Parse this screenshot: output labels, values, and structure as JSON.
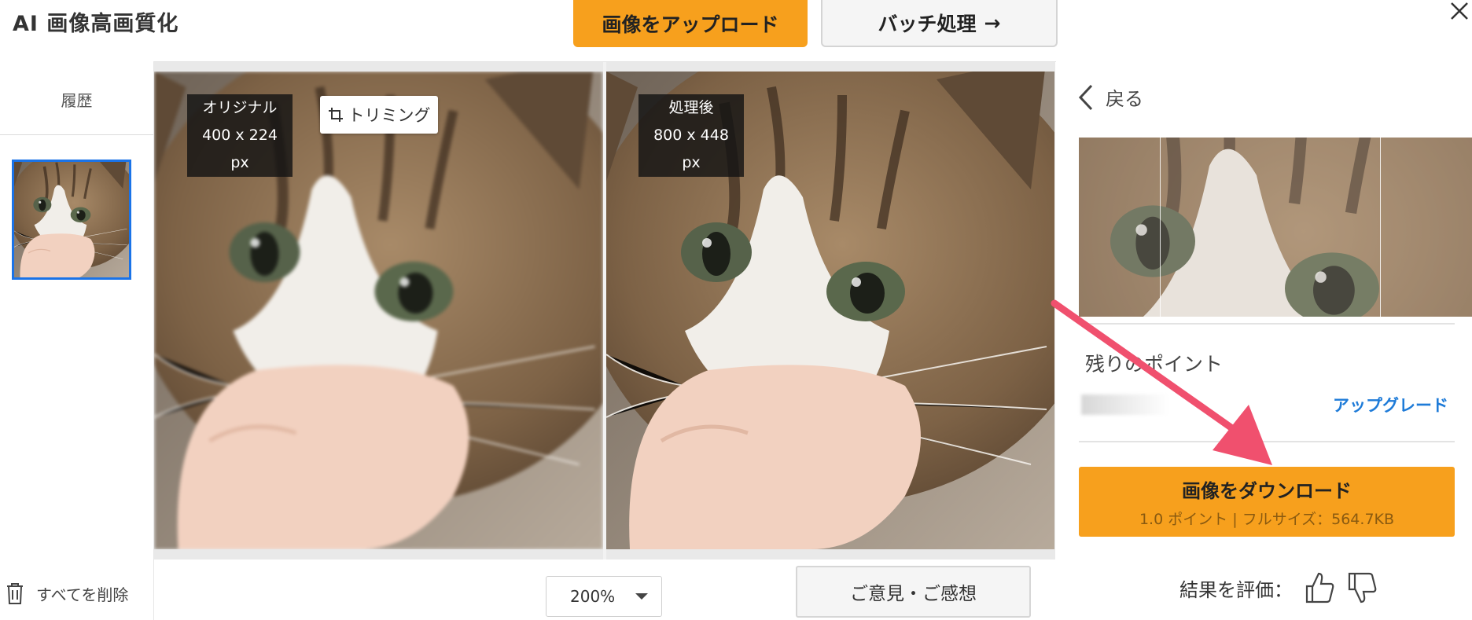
{
  "header": {
    "title": "AI 画像高画質化",
    "upload_label": "画像をアップロード",
    "batch_label": "バッチ処理",
    "batch_arrow": "→"
  },
  "history": {
    "label": "履歴",
    "delete_all_label": "すべてを削除"
  },
  "compare": {
    "original": {
      "title": "オリジナル",
      "size": "400 x 224 px"
    },
    "processed": {
      "title": "処理後",
      "size": "800 x 448 px"
    },
    "crop_label": "トリミング"
  },
  "bottom_bar": {
    "zoom_value": "200%",
    "feedback_label": "ご意見・ご感想"
  },
  "right_panel": {
    "back_label": "戻る",
    "points_label": "残りのポイント",
    "upgrade_label": "アップグレード",
    "download_label": "画像をダウンロード",
    "download_sub": "1.0 ポイント | フルサイズ：564.7KB",
    "rate_label": "結果を評価："
  },
  "colors": {
    "accent_orange": "#f7a01d",
    "selection_blue": "#1a73e8",
    "link_blue": "#1e7bd8",
    "annotation_arrow": "#f0506e"
  },
  "icons": [
    "close-icon",
    "crop-icon",
    "trash-icon",
    "chevron-left-icon",
    "chevron-down-icon",
    "thumbs-up-icon",
    "thumbs-down-icon",
    "arrow-right-icon"
  ]
}
